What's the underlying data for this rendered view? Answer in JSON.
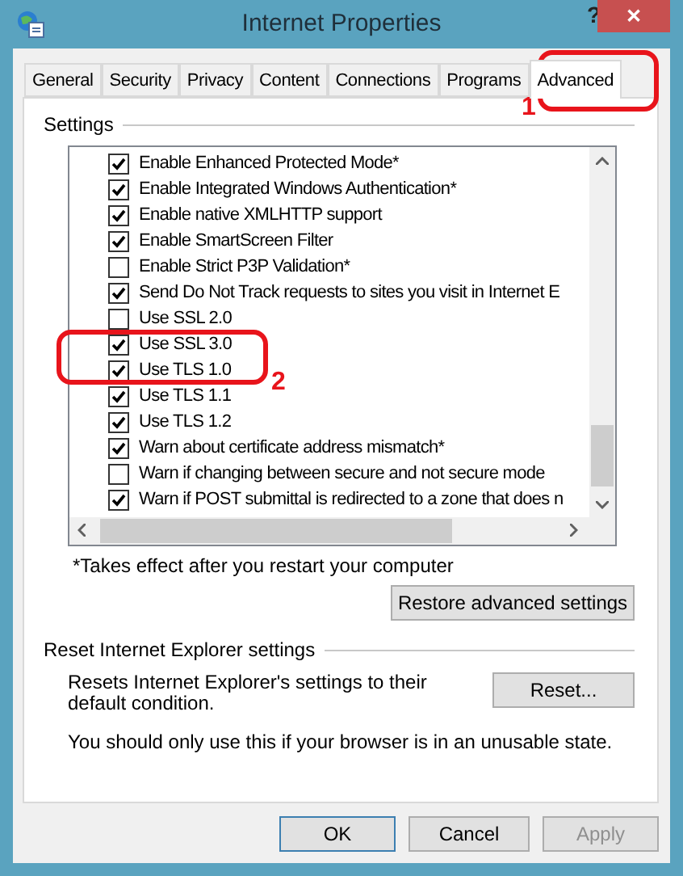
{
  "window": {
    "title": "Internet Properties",
    "help": "?",
    "close": "✕"
  },
  "tabs": [
    {
      "label": "General",
      "selected": false
    },
    {
      "label": "Security",
      "selected": false
    },
    {
      "label": "Privacy",
      "selected": false
    },
    {
      "label": "Content",
      "selected": false
    },
    {
      "label": "Connections",
      "selected": false
    },
    {
      "label": "Programs",
      "selected": false
    },
    {
      "label": "Advanced",
      "selected": true
    }
  ],
  "settings": {
    "title": "Settings",
    "items": [
      {
        "label": "Enable Enhanced Protected Mode*",
        "checked": true
      },
      {
        "label": "Enable Integrated Windows Authentication*",
        "checked": true
      },
      {
        "label": "Enable native XMLHTTP support",
        "checked": true
      },
      {
        "label": "Enable SmartScreen Filter",
        "checked": true
      },
      {
        "label": "Enable Strict P3P Validation*",
        "checked": false
      },
      {
        "label": "Send Do Not Track requests to sites you visit in Internet E",
        "checked": true
      },
      {
        "label": "Use SSL 2.0",
        "checked": false
      },
      {
        "label": "Use SSL 3.0",
        "checked": true
      },
      {
        "label": "Use TLS 1.0",
        "checked": true
      },
      {
        "label": "Use TLS 1.1",
        "checked": true
      },
      {
        "label": "Use TLS 1.2",
        "checked": true
      },
      {
        "label": "Warn about certificate address mismatch*",
        "checked": true
      },
      {
        "label": "Warn if changing between secure and not secure mode",
        "checked": false
      },
      {
        "label": "Warn if POST submittal is redirected to a zone that does n",
        "checked": true
      }
    ],
    "note": "*Takes effect after you restart your computer",
    "restore_button": "Restore advanced settings"
  },
  "reset": {
    "title": "Reset Internet Explorer settings",
    "description": "Resets Internet Explorer's settings to their default condition.",
    "button": "Reset...",
    "warning": "You should only use this if your browser is in an unusable state."
  },
  "buttons": [
    {
      "label": "OK",
      "kind": "default",
      "disabled": false
    },
    {
      "label": "Cancel",
      "kind": "normal",
      "disabled": false
    },
    {
      "label": "Apply",
      "kind": "normal",
      "disabled": true
    }
  ],
  "annotations": [
    {
      "label": "1"
    },
    {
      "label": "2"
    }
  ]
}
